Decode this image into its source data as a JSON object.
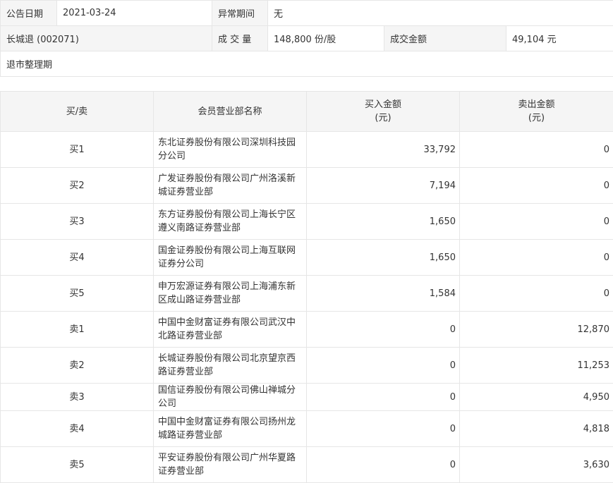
{
  "info": {
    "announce_date_label": "公告日期",
    "announce_date": "2021-03-24",
    "abnormal_period_label": "异常期间",
    "abnormal_period": "无",
    "stock": "长城退 (002071)",
    "volume_label": "成 交 量",
    "volume": "148,800 份/股",
    "amount_label": "成交金额",
    "amount": "49,104 元",
    "reason": "退市整理期"
  },
  "table": {
    "headers": {
      "side": "买/卖",
      "branch": "会员营业部名称",
      "buy_l1": "买入金额",
      "buy_l2": "(元)",
      "sell_l1": "卖出金额",
      "sell_l2": "(元)"
    },
    "rows": [
      {
        "side": "买1",
        "branch": "东北证券股份有限公司深圳科技园分公司",
        "buy": "33,792",
        "sell": "0"
      },
      {
        "side": "买2",
        "branch": "广发证券股份有限公司广州洛溪新城证券营业部",
        "buy": "7,194",
        "sell": "0"
      },
      {
        "side": "买3",
        "branch": "东方证券股份有限公司上海长宁区遵义南路证券营业部",
        "buy": "1,650",
        "sell": "0"
      },
      {
        "side": "买4",
        "branch": "国金证券股份有限公司上海互联网证券分公司",
        "buy": "1,650",
        "sell": "0"
      },
      {
        "side": "买5",
        "branch": "申万宏源证券有限公司上海浦东新区成山路证券营业部",
        "buy": "1,584",
        "sell": "0"
      },
      {
        "side": "卖1",
        "branch": "中国中金财富证券有限公司武汉中北路证券营业部",
        "buy": "0",
        "sell": "12,870"
      },
      {
        "side": "卖2",
        "branch": "长城证券股份有限公司北京望京西路证券营业部",
        "buy": "0",
        "sell": "11,253"
      },
      {
        "side": "卖3",
        "branch": "国信证券股份有限公司佛山禅城分公司",
        "buy": "0",
        "sell": "4,950"
      },
      {
        "side": "卖4",
        "branch": "中国中金财富证券有限公司扬州龙城路证券营业部",
        "buy": "0",
        "sell": "4,818"
      },
      {
        "side": "卖5",
        "branch": "平安证券股份有限公司广州华夏路证券营业部",
        "buy": "0",
        "sell": "3,630"
      }
    ]
  }
}
